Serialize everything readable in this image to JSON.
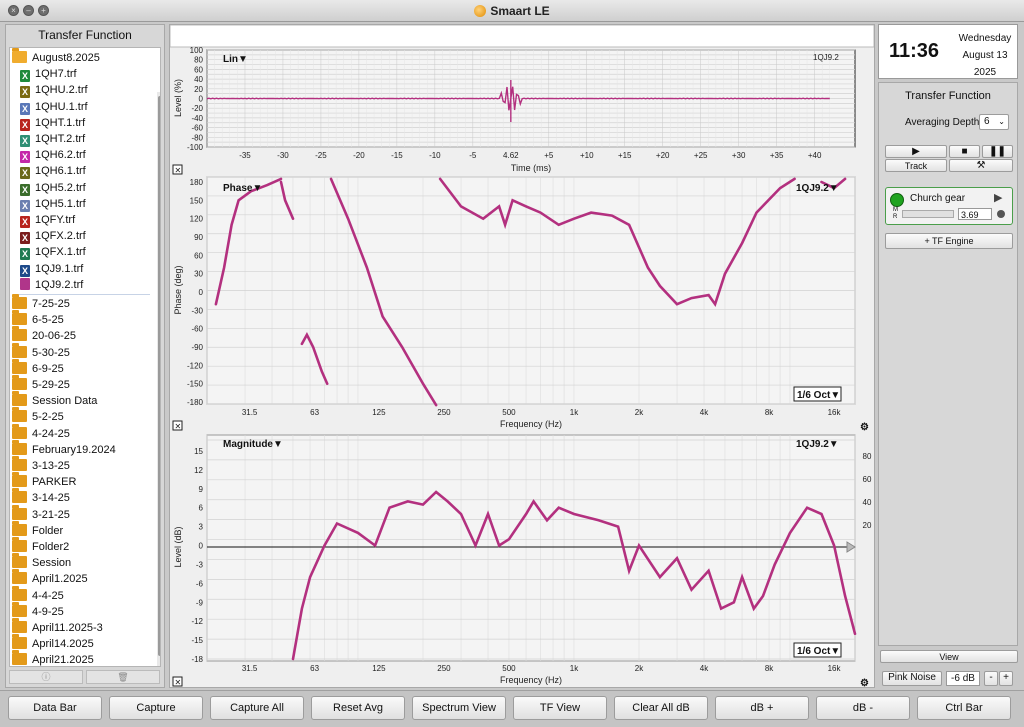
{
  "window": {
    "title": "Smaart LE"
  },
  "left_panel": {
    "title": "Transfer Function",
    "open_folder": "August8.2025",
    "files": [
      {
        "name": "1QH7.trf",
        "color": "#1f8a3b",
        "glyph": "X"
      },
      {
        "name": "1QHU.2.trf",
        "color": "#7b6a12",
        "glyph": "X"
      },
      {
        "name": "1QHU.1.trf",
        "color": "#5a78b8",
        "glyph": "X"
      },
      {
        "name": "1QHT.1.trf",
        "color": "#b8231d",
        "glyph": "X"
      },
      {
        "name": "1QHT.2.trf",
        "color": "#2f8f74",
        "glyph": "X"
      },
      {
        "name": "1QH6.2.trf",
        "color": "#c428a9",
        "glyph": "X"
      },
      {
        "name": "1QH6.1.trf",
        "color": "#6b6a1c",
        "glyph": "X"
      },
      {
        "name": "1QH5.2.trf",
        "color": "#3a6d2b",
        "glyph": "X"
      },
      {
        "name": "1QH5.1.trf",
        "color": "#6b7fb0",
        "glyph": "X"
      },
      {
        "name": "1QFY.trf",
        "color": "#b8231d",
        "glyph": "X"
      },
      {
        "name": "1QFX.2.trf",
        "color": "#7a1d1d",
        "glyph": "X"
      },
      {
        "name": "1QFX.1.trf",
        "color": "#1f7a52",
        "glyph": "X"
      },
      {
        "name": "1QJ9.1.trf",
        "color": "#1d4a8a",
        "glyph": "X"
      },
      {
        "name": "1QJ9.2.trf",
        "color": "#b0358a",
        "glyph": ""
      }
    ],
    "folders": [
      "7-25-25",
      "6-5-25",
      "20-06-25",
      "5-30-25",
      "6-9-25",
      "5-29-25",
      "Session Data",
      "5-2-25",
      "4-24-25",
      "February19.2024",
      "3-13-25",
      "PARKER",
      "3-14-25",
      "3-21-25",
      "Folder",
      "Folder2",
      "Session",
      "April1.2025",
      "4-4-25",
      "4-9-25",
      "April11.2025-3",
      "April14.2025",
      "April21.2025"
    ]
  },
  "clock": {
    "time": "11:36",
    "day": "Wednesday",
    "date": "August 13",
    "year": "2025"
  },
  "right_panel": {
    "title": "Transfer Function",
    "averaging_label": "Averaging Depth:",
    "averaging_value": "6",
    "track_label": "Track",
    "engine_name": "Church gear",
    "engine_m": "M",
    "engine_r": "R",
    "engine_value": "3.69",
    "add_engine": "+ TF Engine",
    "view_label": "View",
    "pink_noise": "Pink Noise",
    "pink_level": "-6 dB",
    "minus": "-",
    "plus": "+"
  },
  "time_plot": {
    "mode": "Lin▼",
    "trace": "1QJ9.2",
    "ylabel": "Level (%)",
    "xlabel": "Time (ms)",
    "yticks": [
      "100",
      "80",
      "60",
      "40",
      "20",
      "0",
      "-20",
      "-40",
      "-60",
      "-80",
      "-100"
    ],
    "xticks": [
      "-35",
      "-30",
      "-25",
      "-20",
      "-15",
      "-10",
      "-5",
      "4.62",
      "+5",
      "+10",
      "+15",
      "+20",
      "+25",
      "+30",
      "+35",
      "+40"
    ]
  },
  "phase_plot": {
    "mode": "Phase▼",
    "trace": "1QJ9.2▼",
    "smoothing": "1/6 Oct▼",
    "ylabel": "Phase (deg)",
    "xlabel": "Frequency (Hz)",
    "yticks": [
      "180",
      "150",
      "120",
      "90",
      "60",
      "30",
      "0",
      "-30",
      "-60",
      "-90",
      "-120",
      "-150",
      "-180"
    ],
    "xticks": [
      "31.5",
      "63",
      "125",
      "250",
      "500",
      "1k",
      "2k",
      "4k",
      "8k",
      "16k"
    ]
  },
  "mag_plot": {
    "mode": "Magnitude▼",
    "trace": "1QJ9.2▼",
    "smoothing": "1/6 Oct▼",
    "ylabel": "Level (dB)",
    "xlabel": "Frequency (Hz)",
    "yticks": [
      "15",
      "12",
      "9",
      "6",
      "3",
      "0",
      "-3",
      "-6",
      "-9",
      "-12",
      "-15",
      "-18"
    ],
    "yticks_right": [
      "80",
      "60",
      "40",
      "20"
    ],
    "xticks": [
      "31.5",
      "63",
      "125",
      "250",
      "500",
      "1k",
      "2k",
      "4k",
      "8k",
      "16k"
    ]
  },
  "bottom_bar": [
    "Data Bar",
    "Capture",
    "Capture All",
    "Reset Avg",
    "Spectrum View",
    "TF View",
    "Clear All dB",
    "dB +",
    "dB -",
    "Ctrl Bar"
  ],
  "colors": {
    "trace": "#b3307f",
    "folder": "#e39a1a"
  }
}
